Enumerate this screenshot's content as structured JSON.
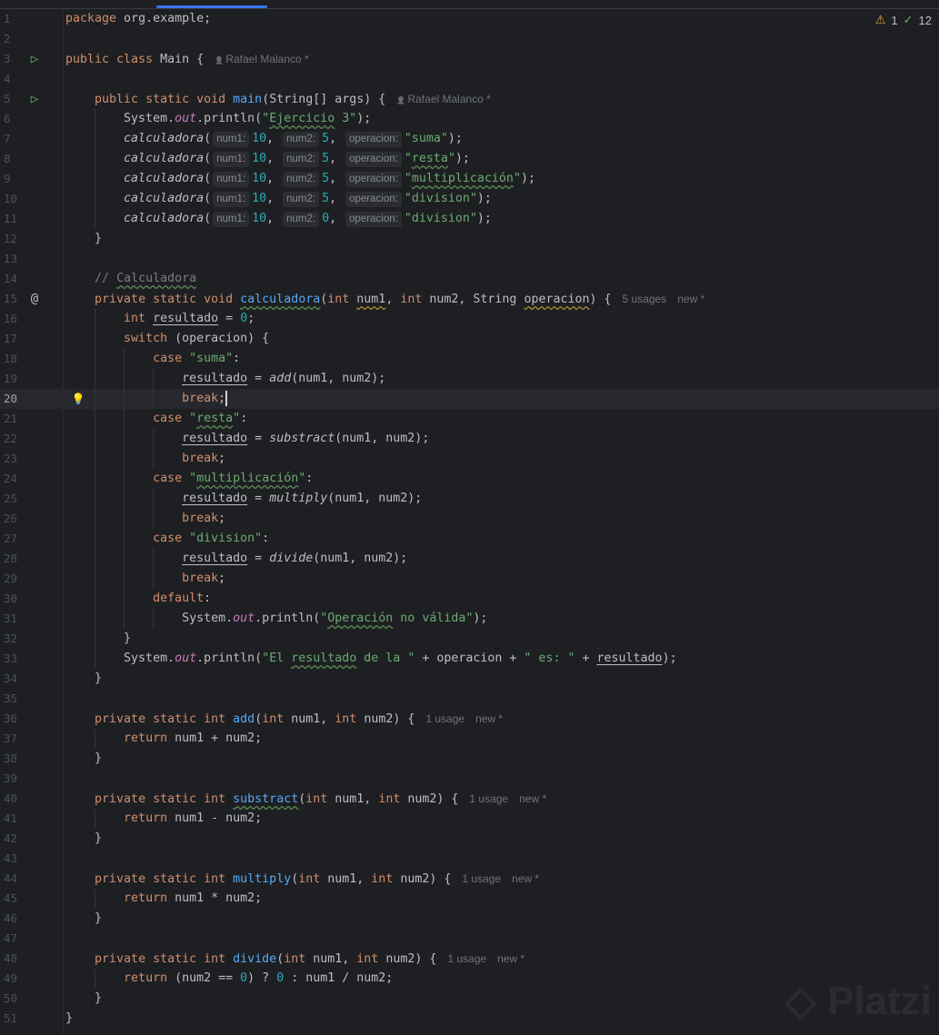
{
  "status": {
    "warnings": "1",
    "checks": "12",
    "warning_icon": "warning-triangle-icon",
    "check_icon": "check-icon"
  },
  "colors": {
    "background": "#1e1f22",
    "keyword": "#cf8e6d",
    "string": "#6aab73",
    "number": "#2aacb8",
    "method": "#56a8f5",
    "static_field": "#c77dbb",
    "comment": "#7a7e85",
    "accent": "#3574f0"
  },
  "watermark": "Platzi",
  "gutter_icons": {
    "3": "run",
    "5": "run",
    "15": "at",
    "20": "bulb"
  },
  "current_line": 20,
  "lines": [
    {
      "n": 1,
      "t": [
        [
          "k",
          "package"
        ],
        [
          "p",
          " org.example;"
        ]
      ]
    },
    {
      "n": 2,
      "t": []
    },
    {
      "n": 3,
      "t": [
        [
          "k",
          "public class"
        ],
        [
          "p",
          " Main {"
        ],
        [
          "a",
          "Rafael Malanco *"
        ]
      ]
    },
    {
      "n": 4,
      "t": []
    },
    {
      "n": 5,
      "t": [
        [
          "p",
          "    "
        ],
        [
          "k",
          "public static void"
        ],
        [
          "p",
          " "
        ],
        [
          "f",
          "main"
        ],
        [
          "p",
          "(String[] args) {"
        ],
        [
          "a",
          "Rafael Malanco *"
        ]
      ]
    },
    {
      "n": 6,
      "t": [
        [
          "p",
          "        System."
        ],
        [
          "s",
          "out"
        ],
        [
          "p",
          ".println("
        ],
        [
          "str",
          "\""
        ],
        [
          "strw",
          "Ejercicio"
        ],
        [
          "str",
          " 3\""
        ],
        [
          "p",
          ");"
        ]
      ]
    },
    {
      "n": 7,
      "t": [
        [
          "p",
          "        "
        ],
        [
          "i",
          "calculadora"
        ],
        [
          "p",
          "("
        ],
        [
          "h",
          "num1:"
        ],
        [
          "n",
          "10"
        ],
        [
          "p",
          ", "
        ],
        [
          "h",
          "num2:"
        ],
        [
          "n",
          "5"
        ],
        [
          "p",
          ", "
        ],
        [
          "h",
          "operacion:"
        ],
        [
          "str",
          "\"suma\""
        ],
        [
          "p",
          ");"
        ]
      ]
    },
    {
      "n": 8,
      "t": [
        [
          "p",
          "        "
        ],
        [
          "i",
          "calculadora"
        ],
        [
          "p",
          "("
        ],
        [
          "h",
          "num1:"
        ],
        [
          "n",
          "10"
        ],
        [
          "p",
          ", "
        ],
        [
          "h",
          "num2:"
        ],
        [
          "n",
          "5"
        ],
        [
          "p",
          ", "
        ],
        [
          "h",
          "operacion:"
        ],
        [
          "str",
          "\""
        ],
        [
          "strw",
          "resta"
        ],
        [
          "str",
          "\""
        ],
        [
          "p",
          ");"
        ]
      ]
    },
    {
      "n": 9,
      "t": [
        [
          "p",
          "        "
        ],
        [
          "i",
          "calculadora"
        ],
        [
          "p",
          "("
        ],
        [
          "h",
          "num1:"
        ],
        [
          "n",
          "10"
        ],
        [
          "p",
          ", "
        ],
        [
          "h",
          "num2:"
        ],
        [
          "n",
          "5"
        ],
        [
          "p",
          ", "
        ],
        [
          "h",
          "operacion:"
        ],
        [
          "str",
          "\""
        ],
        [
          "strw",
          "multiplicación"
        ],
        [
          "str",
          "\""
        ],
        [
          "p",
          ");"
        ]
      ]
    },
    {
      "n": 10,
      "t": [
        [
          "p",
          "        "
        ],
        [
          "i",
          "calculadora"
        ],
        [
          "p",
          "("
        ],
        [
          "h",
          "num1:"
        ],
        [
          "n",
          "10"
        ],
        [
          "p",
          ", "
        ],
        [
          "h",
          "num2:"
        ],
        [
          "n",
          "5"
        ],
        [
          "p",
          ", "
        ],
        [
          "h",
          "operacion:"
        ],
        [
          "str",
          "\"division\""
        ],
        [
          "p",
          ");"
        ]
      ]
    },
    {
      "n": 11,
      "t": [
        [
          "p",
          "        "
        ],
        [
          "i",
          "calculadora"
        ],
        [
          "p",
          "("
        ],
        [
          "h",
          "num1:"
        ],
        [
          "n",
          "10"
        ],
        [
          "p",
          ", "
        ],
        [
          "h",
          "num2:"
        ],
        [
          "n",
          "0"
        ],
        [
          "p",
          ", "
        ],
        [
          "h",
          "operacion:"
        ],
        [
          "str",
          "\"division\""
        ],
        [
          "p",
          ");"
        ]
      ]
    },
    {
      "n": 12,
      "t": [
        [
          "p",
          "    }"
        ]
      ]
    },
    {
      "n": 13,
      "t": []
    },
    {
      "n": 14,
      "t": [
        [
          "p",
          "    "
        ],
        [
          "c",
          "// "
        ],
        [
          "cw",
          "Calculadora"
        ]
      ]
    },
    {
      "n": 15,
      "t": [
        [
          "p",
          "    "
        ],
        [
          "k",
          "private static void"
        ],
        [
          "p",
          " "
        ],
        [
          "fw",
          "calculadora"
        ],
        [
          "p",
          "("
        ],
        [
          "k",
          "int"
        ],
        [
          "p",
          " "
        ],
        [
          "yw",
          "num1"
        ],
        [
          "p",
          ", "
        ],
        [
          "k",
          "int"
        ],
        [
          "p",
          " num2, String "
        ],
        [
          "yw",
          "operacion"
        ],
        [
          "p",
          ") {"
        ],
        [
          "us",
          "5 usages"
        ],
        [
          "us",
          "new *"
        ]
      ]
    },
    {
      "n": 16,
      "t": [
        [
          "p",
          "        "
        ],
        [
          "k",
          "int"
        ],
        [
          "p",
          " "
        ],
        [
          "u",
          "resultado"
        ],
        [
          "p",
          " = "
        ],
        [
          "n",
          "0"
        ],
        [
          "p",
          ";"
        ]
      ]
    },
    {
      "n": 17,
      "t": [
        [
          "p",
          "        "
        ],
        [
          "k",
          "switch"
        ],
        [
          "p",
          " (operacion) {"
        ]
      ]
    },
    {
      "n": 18,
      "t": [
        [
          "p",
          "            "
        ],
        [
          "k",
          "case"
        ],
        [
          "p",
          " "
        ],
        [
          "str",
          "\"suma\""
        ],
        [
          "p",
          ":"
        ]
      ]
    },
    {
      "n": 19,
      "t": [
        [
          "p",
          "                "
        ],
        [
          "u",
          "resultado"
        ],
        [
          "p",
          " = "
        ],
        [
          "i",
          "add"
        ],
        [
          "p",
          "(num1, num2);"
        ]
      ]
    },
    {
      "n": 20,
      "t": [
        [
          "p",
          "                "
        ],
        [
          "k",
          "break"
        ],
        [
          "p",
          ";"
        ],
        [
          "caret",
          ""
        ]
      ]
    },
    {
      "n": 21,
      "t": [
        [
          "p",
          "            "
        ],
        [
          "k",
          "case"
        ],
        [
          "p",
          " "
        ],
        [
          "str",
          "\""
        ],
        [
          "strw",
          "resta"
        ],
        [
          "str",
          "\""
        ],
        [
          "p",
          ":"
        ]
      ]
    },
    {
      "n": 22,
      "t": [
        [
          "p",
          "                "
        ],
        [
          "u",
          "resultado"
        ],
        [
          "p",
          " = "
        ],
        [
          "i",
          "substract"
        ],
        [
          "p",
          "(num1, num2);"
        ]
      ]
    },
    {
      "n": 23,
      "t": [
        [
          "p",
          "                "
        ],
        [
          "k",
          "break"
        ],
        [
          "p",
          ";"
        ]
      ]
    },
    {
      "n": 24,
      "t": [
        [
          "p",
          "            "
        ],
        [
          "k",
          "case"
        ],
        [
          "p",
          " "
        ],
        [
          "str",
          "\""
        ],
        [
          "strw",
          "multiplicación"
        ],
        [
          "str",
          "\""
        ],
        [
          "p",
          ":"
        ]
      ]
    },
    {
      "n": 25,
      "t": [
        [
          "p",
          "                "
        ],
        [
          "u",
          "resultado"
        ],
        [
          "p",
          " = "
        ],
        [
          "i",
          "multiply"
        ],
        [
          "p",
          "(num1, num2);"
        ]
      ]
    },
    {
      "n": 26,
      "t": [
        [
          "p",
          "                "
        ],
        [
          "k",
          "break"
        ],
        [
          "p",
          ";"
        ]
      ]
    },
    {
      "n": 27,
      "t": [
        [
          "p",
          "            "
        ],
        [
          "k",
          "case"
        ],
        [
          "p",
          " "
        ],
        [
          "str",
          "\"division\""
        ],
        [
          "p",
          ":"
        ]
      ]
    },
    {
      "n": 28,
      "t": [
        [
          "p",
          "                "
        ],
        [
          "u",
          "resultado"
        ],
        [
          "p",
          " = "
        ],
        [
          "i",
          "divide"
        ],
        [
          "p",
          "(num1, num2);"
        ]
      ]
    },
    {
      "n": 29,
      "t": [
        [
          "p",
          "                "
        ],
        [
          "k",
          "break"
        ],
        [
          "p",
          ";"
        ]
      ]
    },
    {
      "n": 30,
      "t": [
        [
          "p",
          "            "
        ],
        [
          "k",
          "default"
        ],
        [
          "p",
          ":"
        ]
      ]
    },
    {
      "n": 31,
      "t": [
        [
          "p",
          "                System."
        ],
        [
          "s",
          "out"
        ],
        [
          "p",
          ".println("
        ],
        [
          "str",
          "\""
        ],
        [
          "strw",
          "Operación"
        ],
        [
          "str",
          " no válida\""
        ],
        [
          "p",
          ");"
        ]
      ]
    },
    {
      "n": 32,
      "t": [
        [
          "p",
          "        }"
        ]
      ]
    },
    {
      "n": 33,
      "t": [
        [
          "p",
          "        System."
        ],
        [
          "s",
          "out"
        ],
        [
          "p",
          ".println("
        ],
        [
          "str",
          "\"El "
        ],
        [
          "strw",
          "resultado"
        ],
        [
          "str",
          " de la \""
        ],
        [
          "p",
          " + operacion + "
        ],
        [
          "str",
          "\" es: \""
        ],
        [
          "p",
          " + "
        ],
        [
          "u",
          "resultado"
        ],
        [
          "p",
          ");"
        ]
      ]
    },
    {
      "n": 34,
      "t": [
        [
          "p",
          "    }"
        ]
      ]
    },
    {
      "n": 35,
      "t": []
    },
    {
      "n": 36,
      "t": [
        [
          "p",
          "    "
        ],
        [
          "k",
          "private static int"
        ],
        [
          "p",
          " "
        ],
        [
          "f",
          "add"
        ],
        [
          "p",
          "("
        ],
        [
          "k",
          "int"
        ],
        [
          "p",
          " num1, "
        ],
        [
          "k",
          "int"
        ],
        [
          "p",
          " num2) {"
        ],
        [
          "us",
          "1 usage"
        ],
        [
          "us",
          "new *"
        ]
      ]
    },
    {
      "n": 37,
      "t": [
        [
          "p",
          "        "
        ],
        [
          "k",
          "return"
        ],
        [
          "p",
          " num1 + num2;"
        ]
      ]
    },
    {
      "n": 38,
      "t": [
        [
          "p",
          "    }"
        ]
      ]
    },
    {
      "n": 39,
      "t": []
    },
    {
      "n": 40,
      "t": [
        [
          "p",
          "    "
        ],
        [
          "k",
          "private static int"
        ],
        [
          "p",
          " "
        ],
        [
          "fw",
          "substract"
        ],
        [
          "p",
          "("
        ],
        [
          "k",
          "int"
        ],
        [
          "p",
          " num1, "
        ],
        [
          "k",
          "int"
        ],
        [
          "p",
          " num2) {"
        ],
        [
          "us",
          "1 usage"
        ],
        [
          "us",
          "new *"
        ]
      ]
    },
    {
      "n": 41,
      "t": [
        [
          "p",
          "        "
        ],
        [
          "k",
          "return"
        ],
        [
          "p",
          " num1 - num2;"
        ]
      ]
    },
    {
      "n": 42,
      "t": [
        [
          "p",
          "    }"
        ]
      ]
    },
    {
      "n": 43,
      "t": []
    },
    {
      "n": 44,
      "t": [
        [
          "p",
          "    "
        ],
        [
          "k",
          "private static int"
        ],
        [
          "p",
          " "
        ],
        [
          "f",
          "multiply"
        ],
        [
          "p",
          "("
        ],
        [
          "k",
          "int"
        ],
        [
          "p",
          " num1, "
        ],
        [
          "k",
          "int"
        ],
        [
          "p",
          " num2) {"
        ],
        [
          "us",
          "1 usage"
        ],
        [
          "us",
          "new *"
        ]
      ]
    },
    {
      "n": 45,
      "t": [
        [
          "p",
          "        "
        ],
        [
          "k",
          "return"
        ],
        [
          "p",
          " num1 * num2;"
        ]
      ]
    },
    {
      "n": 46,
      "t": [
        [
          "p",
          "    }"
        ]
      ]
    },
    {
      "n": 47,
      "t": []
    },
    {
      "n": 48,
      "t": [
        [
          "p",
          "    "
        ],
        [
          "k",
          "private static int"
        ],
        [
          "p",
          " "
        ],
        [
          "f",
          "divide"
        ],
        [
          "p",
          "("
        ],
        [
          "k",
          "int"
        ],
        [
          "p",
          " num1, "
        ],
        [
          "k",
          "int"
        ],
        [
          "p",
          " num2) {"
        ],
        [
          "us",
          "1 usage"
        ],
        [
          "us",
          "new *"
        ]
      ]
    },
    {
      "n": 49,
      "t": [
        [
          "p",
          "        "
        ],
        [
          "k",
          "return"
        ],
        [
          "p",
          " (num2 == "
        ],
        [
          "n",
          "0"
        ],
        [
          "p",
          ") ? "
        ],
        [
          "n",
          "0"
        ],
        [
          "p",
          " : num1 / num2;"
        ]
      ]
    },
    {
      "n": 50,
      "t": [
        [
          "p",
          "    }"
        ]
      ]
    },
    {
      "n": 51,
      "t": [
        [
          "p",
          "}"
        ]
      ]
    }
  ]
}
